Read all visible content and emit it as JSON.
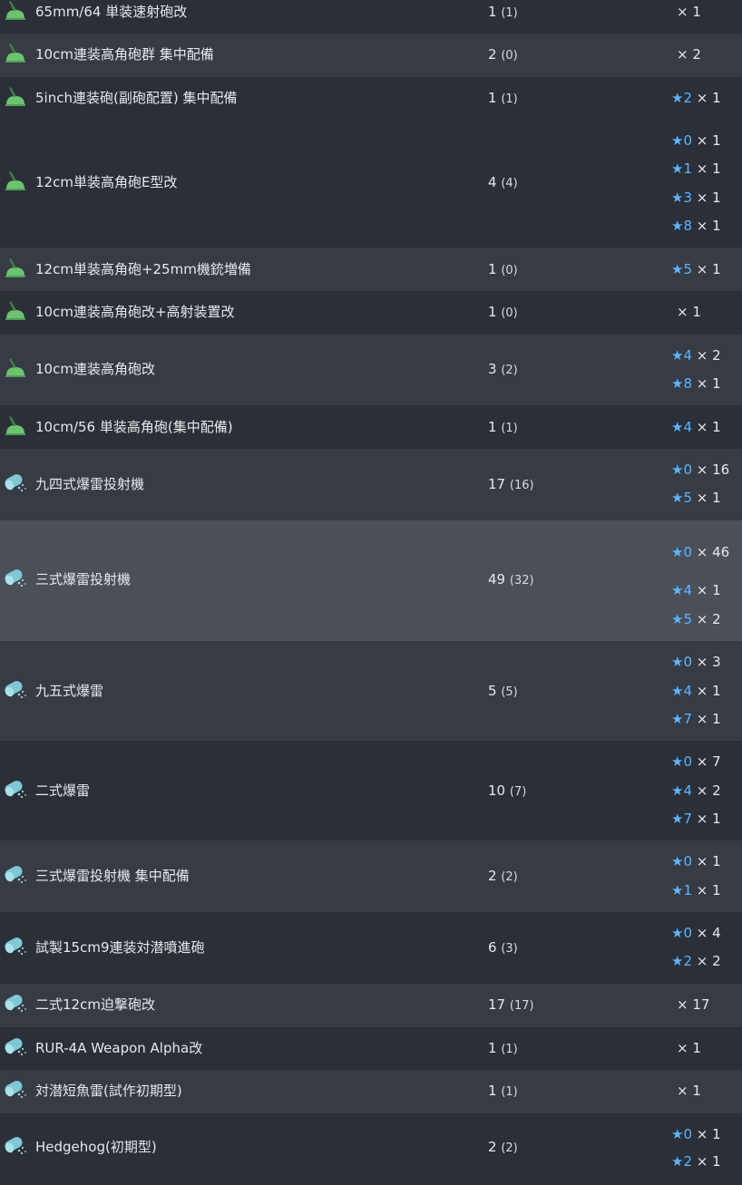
{
  "colors": {
    "row_dark": "#2b2f37",
    "row_light": "#373b44",
    "row_hover": "#4b4f58",
    "star": "#5fb4ff",
    "gun_icon": "#6cc46f",
    "depth_icon": "#7fc8d6"
  },
  "rows": [
    {
      "name": "65mm/64 単装速射砲改",
      "total": "1",
      "sub": "(1)",
      "icon": "aa-gun-icon",
      "stars": [
        {
          "star": "",
          "mult": "× 1"
        }
      ]
    },
    {
      "name": "10cm連装高角砲群 集中配備",
      "total": "2",
      "sub": "(0)",
      "icon": "aa-gun-icon",
      "stars": [
        {
          "star": "",
          "mult": "× 2"
        }
      ]
    },
    {
      "name": "5inch連装砲(副砲配置) 集中配備",
      "total": "1",
      "sub": "(1)",
      "icon": "aa-gun-icon",
      "stars": [
        {
          "star": "★2",
          "mult": "× 1"
        }
      ]
    },
    {
      "name": "12cm単装高角砲E型改",
      "total": "4",
      "sub": "(4)",
      "icon": "aa-gun-icon",
      "stars": [
        {
          "star": "★0",
          "mult": "× 1"
        },
        {
          "star": "★1",
          "mult": "× 1"
        },
        {
          "star": "★3",
          "mult": "× 1"
        },
        {
          "star": "★8",
          "mult": "× 1"
        }
      ]
    },
    {
      "name": "12cm単装高角砲+25mm機銃増備",
      "total": "1",
      "sub": "(0)",
      "icon": "aa-gun-icon",
      "stars": [
        {
          "star": "★5",
          "mult": "× 1"
        }
      ]
    },
    {
      "name": "10cm連装高角砲改+高射装置改",
      "total": "1",
      "sub": "(0)",
      "icon": "aa-gun-icon",
      "stars": [
        {
          "star": "",
          "mult": "× 1"
        }
      ]
    },
    {
      "name": "10cm連装高角砲改",
      "total": "3",
      "sub": "(2)",
      "icon": "aa-gun-icon",
      "stars": [
        {
          "star": "★4",
          "mult": "× 2"
        },
        {
          "star": "★8",
          "mult": "× 1"
        }
      ]
    },
    {
      "name": "10cm/56 単装高角砲(集中配備)",
      "total": "1",
      "sub": "(1)",
      "icon": "aa-gun-icon",
      "stars": [
        {
          "star": "★4",
          "mult": "× 1"
        }
      ]
    },
    {
      "name": "九四式爆雷投射機",
      "total": "17",
      "sub": "(16)",
      "icon": "depth-charge-icon",
      "stars": [
        {
          "star": "★0",
          "mult": "× 16"
        },
        {
          "star": "★5",
          "mult": "× 1"
        }
      ]
    },
    {
      "name": "三式爆雷投射機",
      "total": "49",
      "sub": "(32)",
      "icon": "depth-charge-icon",
      "stars": [
        {
          "star": "★0",
          "mult": "× 46"
        },
        {
          "star": "★4",
          "mult": "× 1"
        },
        {
          "star": "★5",
          "mult": "× 2"
        }
      ]
    },
    {
      "name": "九五式爆雷",
      "total": "5",
      "sub": "(5)",
      "icon": "depth-charge-icon",
      "stars": [
        {
          "star": "★0",
          "mult": "× 3"
        },
        {
          "star": "★4",
          "mult": "× 1"
        },
        {
          "star": "★7",
          "mult": "× 1"
        }
      ]
    },
    {
      "name": "二式爆雷",
      "total": "10",
      "sub": "(7)",
      "icon": "depth-charge-icon",
      "stars": [
        {
          "star": "★0",
          "mult": "× 7"
        },
        {
          "star": "★4",
          "mult": "× 2"
        },
        {
          "star": "★7",
          "mult": "× 1"
        }
      ]
    },
    {
      "name": "三式爆雷投射機 集中配備",
      "total": "2",
      "sub": "(2)",
      "icon": "depth-charge-icon",
      "stars": [
        {
          "star": "★0",
          "mult": "× 1"
        },
        {
          "star": "★1",
          "mult": "× 1"
        }
      ]
    },
    {
      "name": "試製15cm9連装対潜噴進砲",
      "total": "6",
      "sub": "(3)",
      "icon": "depth-charge-icon",
      "stars": [
        {
          "star": "★0",
          "mult": "× 4"
        },
        {
          "star": "★2",
          "mult": "× 2"
        }
      ]
    },
    {
      "name": "二式12cm迫撃砲改",
      "total": "17",
      "sub": "(17)",
      "icon": "depth-charge-icon",
      "stars": [
        {
          "star": "",
          "mult": "× 17"
        }
      ]
    },
    {
      "name": "RUR-4A Weapon Alpha改",
      "total": "1",
      "sub": "(1)",
      "icon": "depth-charge-icon",
      "stars": [
        {
          "star": "",
          "mult": "× 1"
        }
      ]
    },
    {
      "name": "対潜短魚雷(試作初期型)",
      "total": "1",
      "sub": "(1)",
      "icon": "depth-charge-icon",
      "stars": [
        {
          "star": "",
          "mult": "× 1"
        }
      ]
    },
    {
      "name": "Hedgehog(初期型)",
      "total": "2",
      "sub": "(2)",
      "icon": "depth-charge-icon",
      "stars": [
        {
          "star": "★0",
          "mult": "× 1"
        },
        {
          "star": "★2",
          "mult": "× 1"
        }
      ]
    }
  ]
}
